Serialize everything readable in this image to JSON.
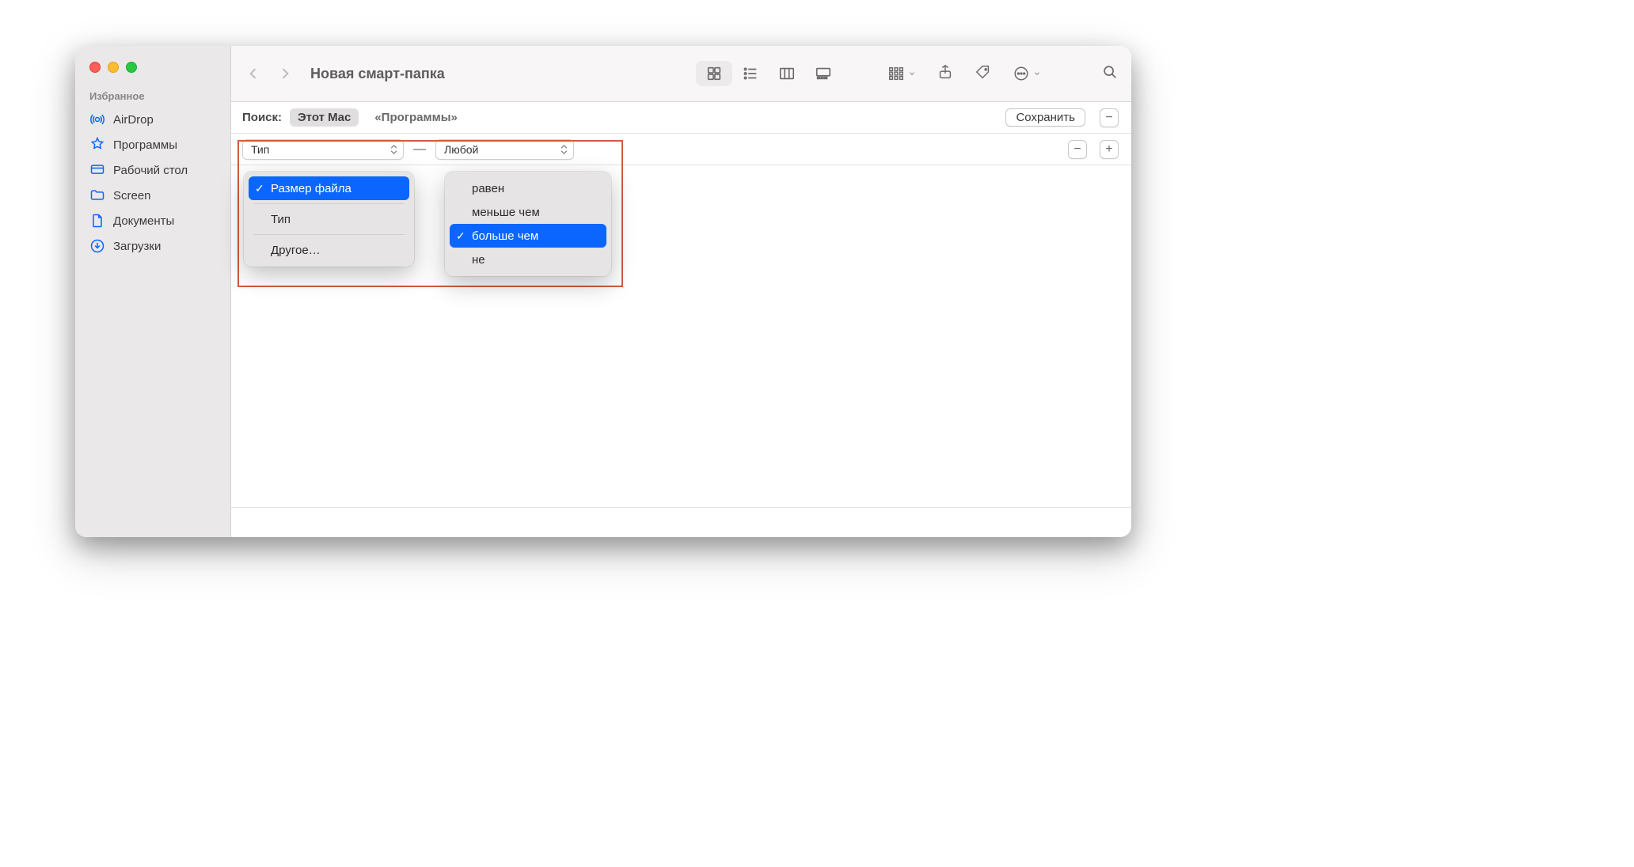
{
  "header": {
    "title": "Новая смарт-папка"
  },
  "sidebar": {
    "section": "Избранное",
    "items": [
      {
        "label": "AirDrop"
      },
      {
        "label": "Программы"
      },
      {
        "label": "Рабочий стол"
      },
      {
        "label": "Screen"
      },
      {
        "label": "Документы"
      },
      {
        "label": "Загрузки"
      }
    ]
  },
  "search": {
    "label": "Поиск:",
    "scopes": [
      "Этот Mac",
      "«Программы»"
    ],
    "save": "Сохранить"
  },
  "criteria": {
    "select1": "Тип",
    "dash": "—",
    "select2": "Любой"
  },
  "popover1": {
    "items": [
      "Размер файла",
      "Тип",
      "Другое…"
    ],
    "selected_index": 0
  },
  "popover2": {
    "items": [
      "равен",
      "меньше чем",
      "больше чем",
      "не"
    ],
    "selected_index": 2
  },
  "colors": {
    "accent": "#0a66ff",
    "annotation": "#d35b3f"
  }
}
